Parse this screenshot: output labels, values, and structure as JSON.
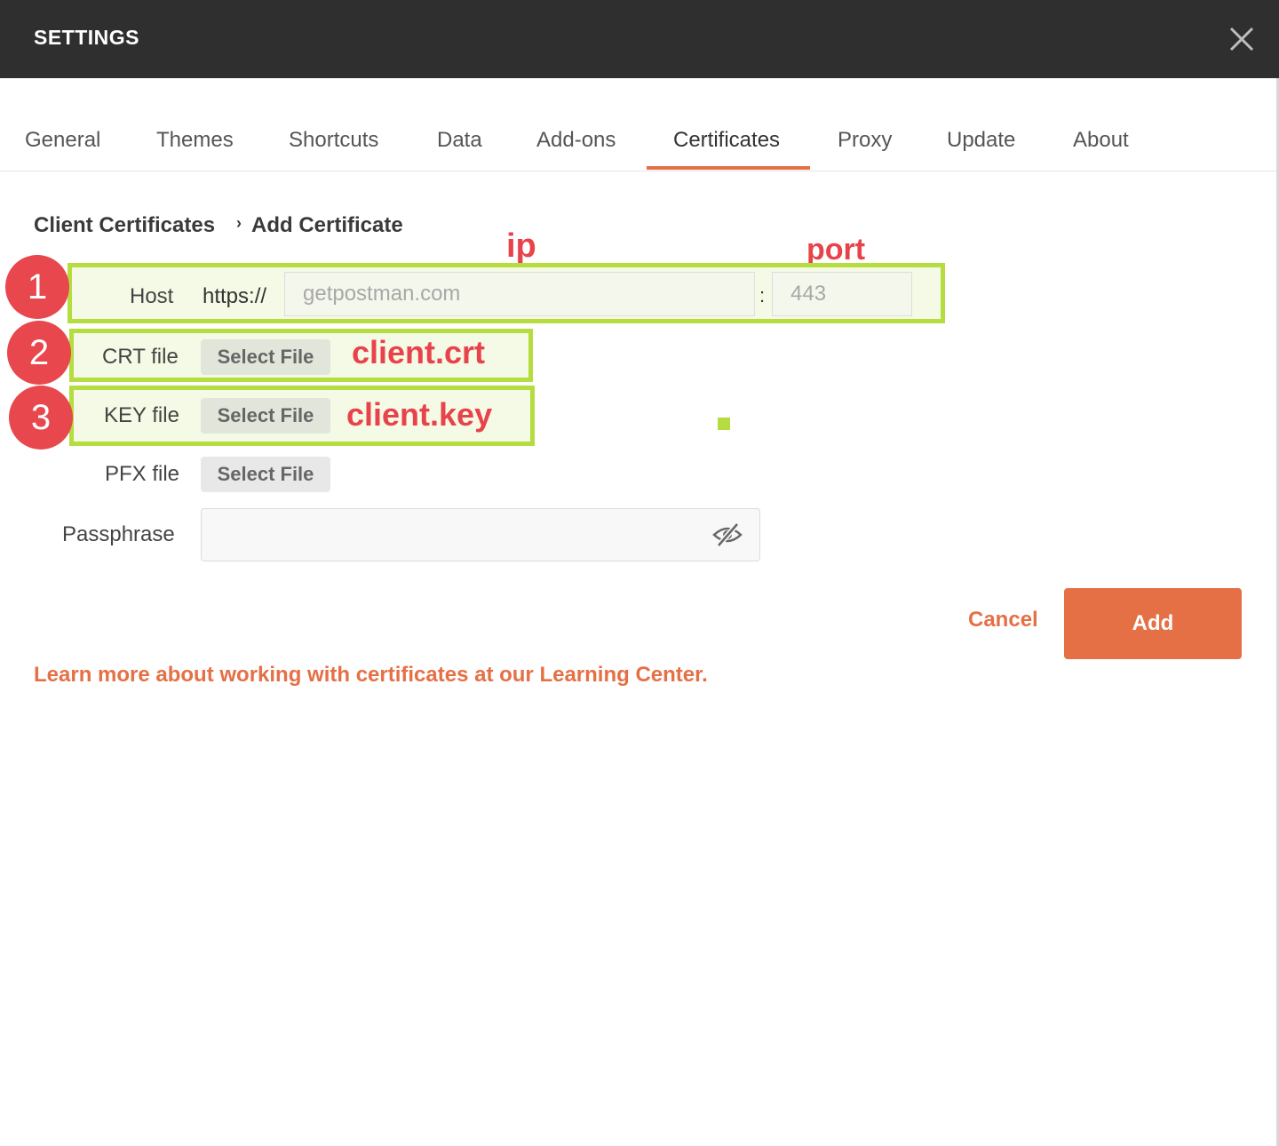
{
  "header": {
    "title": "SETTINGS",
    "close_icon": "close-icon"
  },
  "tabs": [
    {
      "label": "General"
    },
    {
      "label": "Themes"
    },
    {
      "label": "Shortcuts"
    },
    {
      "label": "Data"
    },
    {
      "label": "Add-ons"
    },
    {
      "label": "Certificates",
      "active": true
    },
    {
      "label": "Proxy"
    },
    {
      "label": "Update"
    },
    {
      "label": "About"
    }
  ],
  "breadcrumb": {
    "parent": "Client Certificates",
    "current": "Add Certificate"
  },
  "form": {
    "host_label": "Host",
    "https_prefix": "https://",
    "host_placeholder": "getpostman.com",
    "colon": ":",
    "port_placeholder": "443",
    "crt_label": "CRT file",
    "key_label": "KEY file",
    "pfx_label": "PFX file",
    "select_file_label": "Select File",
    "passphrase_label": "Passphrase",
    "passphrase_icon": "eye-off-icon"
  },
  "actions": {
    "cancel_label": "Cancel",
    "add_label": "Add"
  },
  "learn_more": "Learn more about working with certificates at our Learning Center.",
  "annotations": {
    "ip_label": "ip",
    "port_label": "port",
    "crt_note": "client.crt",
    "key_note": "client.key",
    "steps": [
      "1",
      "2",
      "3"
    ]
  },
  "colors": {
    "accent": "#e57045",
    "header_bg": "#2f2f2f",
    "annotation_red": "#e8434b",
    "annotation_green": "#b6dd3f"
  }
}
